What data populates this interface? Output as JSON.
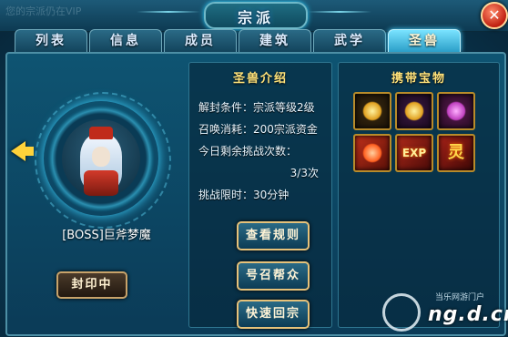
{
  "window": {
    "title": "宗派",
    "faded_top_text": "您的宗派仍在VIP"
  },
  "tabs": [
    {
      "label": "列表"
    },
    {
      "label": "信息"
    },
    {
      "label": "成员"
    },
    {
      "label": "建筑"
    },
    {
      "label": "武学"
    },
    {
      "label": "圣兽",
      "active": true
    }
  ],
  "boss": {
    "name": "[BOSS]巨斧梦魔",
    "seal_button": "封印中"
  },
  "info": {
    "title": "圣兽介绍",
    "unlock": "解封条件：宗派等级2级",
    "summon_cost": "召唤消耗：200宗派资金",
    "remaining_label": "今日剩余挑战次数：",
    "remaining_value": "3/3次",
    "time_limit": "挑战限时：30分钟",
    "buttons": {
      "rules": "查看规则",
      "summon": "号召帮众",
      "return": "快速回宗"
    }
  },
  "treasure": {
    "title": "携带宝物",
    "items": [
      {
        "icon": "gold-orb-icon"
      },
      {
        "icon": "gold-gem-icon"
      },
      {
        "icon": "purple-gem-icon"
      },
      {
        "icon": "red-talisman-icon"
      },
      {
        "icon": "exp-icon",
        "label": "EXP"
      },
      {
        "icon": "spirit-icon",
        "label": "灵"
      }
    ]
  },
  "watermark": {
    "sub": "当乐网游门户",
    "main": "ng.d.cn"
  },
  "colors": {
    "accent_gold": "#ffe27a",
    "active_tab": "#7ae3ff",
    "panel_bg": "#0e5472",
    "close_red": "#c02010"
  }
}
